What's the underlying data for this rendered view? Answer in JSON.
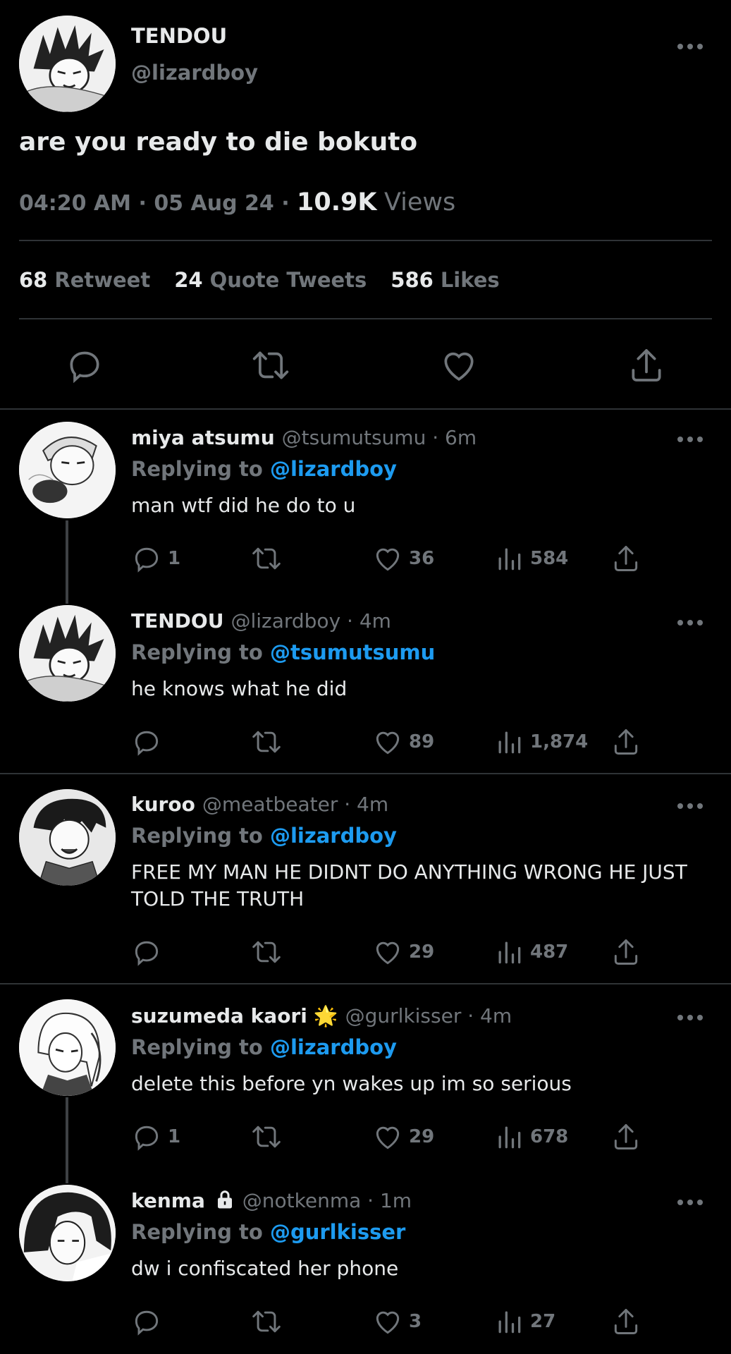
{
  "main_tweet": {
    "name": "TENDOU",
    "handle": "@lizardboy",
    "text": "are you ready to die bokuto",
    "time": "04:20 AM",
    "date": "05 Aug 24",
    "views_count": "10.9K",
    "views_label": "Views",
    "retweets": "68",
    "retweets_label": "Retweet",
    "quotes": "24",
    "quotes_label": "Quote Tweets",
    "likes": "586",
    "likes_label": "Likes"
  },
  "replies": [
    {
      "name": "miya atsumu",
      "handle": "@tsumutsumu · 6m",
      "replying_prefix": "Replying to",
      "replying_to": "@lizardboy",
      "text": "man wtf did he do to u",
      "replies": "1",
      "likes": "36",
      "views": "584"
    },
    {
      "name": "TENDOU",
      "handle": "@lizardboy · 4m",
      "replying_prefix": "Replying to",
      "replying_to": "@tsumutsumu",
      "text": "he knows what he did",
      "replies": "",
      "likes": "89",
      "views": "1,874"
    },
    {
      "name": "kuroo",
      "handle": "@meatbeater · 4m",
      "replying_prefix": "Replying to",
      "replying_to": "@lizardboy",
      "text": "FREE MY MAN HE DIDNT DO ANYTHING WRONG HE JUST TOLD THE TRUTH",
      "replies": "",
      "likes": "29",
      "views": "487"
    },
    {
      "name": "suzumeda kaori",
      "name_emoji": "🌟",
      "handle": "@gurlkisser · 4m",
      "replying_prefix": "Replying to",
      "replying_to": "@lizardboy",
      "text": "delete this before yn wakes up im so serious",
      "replies": "1",
      "likes": "29",
      "views": "678"
    },
    {
      "name": "kenma",
      "name_icon": "lock-icon",
      "handle": "@notkenma · 1m",
      "replying_prefix": "Replying to",
      "replying_to": "@gurlkisser",
      "text": "dw i confiscated her phone",
      "replies": "",
      "likes": "3",
      "views": "27"
    }
  ],
  "colors": {
    "background": "#000000",
    "text": "#e7e9ea",
    "muted": "#71767b",
    "link": "#1d9bf0",
    "divider": "#2f3336"
  }
}
